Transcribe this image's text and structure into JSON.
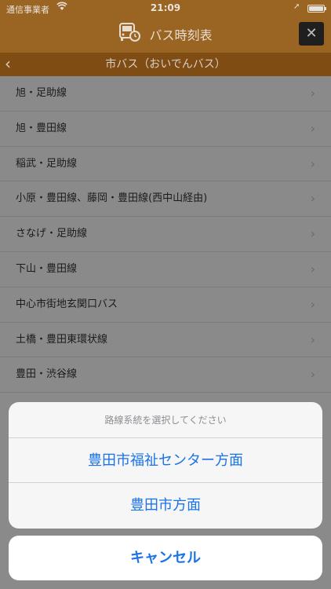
{
  "status_bar": {
    "carrier": "通信事業者",
    "time": "21:09"
  },
  "header": {
    "title": "バス時刻表",
    "icon": "bus-clock-icon",
    "close_label": "✕"
  },
  "subheader": {
    "title": "市バス（おいでんバス）"
  },
  "routes": [
    {
      "label": "旭・足助線"
    },
    {
      "label": "旭・豊田線"
    },
    {
      "label": "稲武・足助線"
    },
    {
      "label": "小原・豊田線、藤岡・豊田線(西中山経由)"
    },
    {
      "label": "さなげ・足助線"
    },
    {
      "label": "下山・豊田線"
    },
    {
      "label": "中心市街地玄関口バス"
    },
    {
      "label": "土橋・豊田東環状線"
    },
    {
      "label": "豊田・渋谷線"
    }
  ],
  "action_sheet": {
    "title": "路線系統を選択してください",
    "options": [
      {
        "label": "豊田市福祉センター方面"
      },
      {
        "label": "豊田市方面"
      }
    ],
    "cancel_label": "キャンセル"
  },
  "colors": {
    "accent": "#1a73e8",
    "header_orange": "#e8982f",
    "subheader_orange": "#c96f12"
  }
}
